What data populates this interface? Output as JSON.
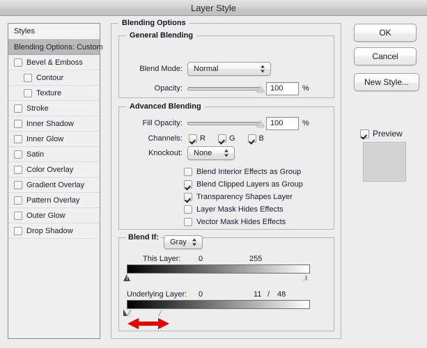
{
  "window": {
    "title": "Layer Style"
  },
  "sidebar": {
    "header": "Styles",
    "items": [
      {
        "label": "Blending Options: Custom",
        "selected": true,
        "checkbox": false,
        "indent": false
      },
      {
        "label": "Bevel & Emboss",
        "selected": false,
        "checkbox": true,
        "checked": false,
        "indent": false
      },
      {
        "label": "Contour",
        "selected": false,
        "checkbox": true,
        "checked": false,
        "indent": true
      },
      {
        "label": "Texture",
        "selected": false,
        "checkbox": true,
        "checked": false,
        "indent": true
      },
      {
        "label": "Stroke",
        "selected": false,
        "checkbox": true,
        "checked": false,
        "indent": false
      },
      {
        "label": "Inner Shadow",
        "selected": false,
        "checkbox": true,
        "checked": false,
        "indent": false
      },
      {
        "label": "Inner Glow",
        "selected": false,
        "checkbox": true,
        "checked": false,
        "indent": false
      },
      {
        "label": "Satin",
        "selected": false,
        "checkbox": true,
        "checked": false,
        "indent": false
      },
      {
        "label": "Color Overlay",
        "selected": false,
        "checkbox": true,
        "checked": false,
        "indent": false
      },
      {
        "label": "Gradient Overlay",
        "selected": false,
        "checkbox": true,
        "checked": false,
        "indent": false
      },
      {
        "label": "Pattern Overlay",
        "selected": false,
        "checkbox": true,
        "checked": false,
        "indent": false
      },
      {
        "label": "Outer Glow",
        "selected": false,
        "checkbox": true,
        "checked": false,
        "indent": false
      },
      {
        "label": "Drop Shadow",
        "selected": false,
        "checkbox": true,
        "checked": false,
        "indent": false
      }
    ]
  },
  "panels": {
    "blending_options_title": "Blending Options",
    "general_blending": {
      "title": "General Blending",
      "blend_mode_label": "Blend Mode:",
      "blend_mode_value": "Normal",
      "opacity_label": "Opacity:",
      "opacity_value": "100",
      "opacity_unit": "%",
      "opacity_percent": 100
    },
    "advanced_blending": {
      "title": "Advanced Blending",
      "fill_opacity_label": "Fill Opacity:",
      "fill_opacity_value": "100",
      "fill_opacity_unit": "%",
      "fill_opacity_percent": 100,
      "channels_label": "Channels:",
      "channels": [
        {
          "label": "R",
          "checked": true
        },
        {
          "label": "G",
          "checked": true
        },
        {
          "label": "B",
          "checked": true
        }
      ],
      "knockout_label": "Knockout:",
      "knockout_value": "None",
      "options": [
        {
          "label": "Blend Interior Effects as Group",
          "checked": false
        },
        {
          "label": "Blend Clipped Layers as Group",
          "checked": true
        },
        {
          "label": "Transparency Shapes Layer",
          "checked": true
        },
        {
          "label": "Layer Mask Hides Effects",
          "checked": false
        },
        {
          "label": "Vector Mask Hides Effects",
          "checked": false
        }
      ]
    },
    "blend_if": {
      "title": "Blend If:",
      "channel_value": "Gray",
      "this_layer": {
        "label": "This Layer:",
        "low": "0",
        "high": "255"
      },
      "underlying_layer": {
        "label": "Underlying Layer:",
        "low": "0",
        "high_low": "11",
        "separator": "/",
        "high_high": "48"
      }
    }
  },
  "buttons": {
    "ok": "OK",
    "cancel": "Cancel",
    "new_style": "New Style...",
    "preview_label": "Preview",
    "preview_checked": true
  },
  "annotation": {
    "arrow_color": "#e60000",
    "arrow_name": "drag-range-indicator"
  }
}
